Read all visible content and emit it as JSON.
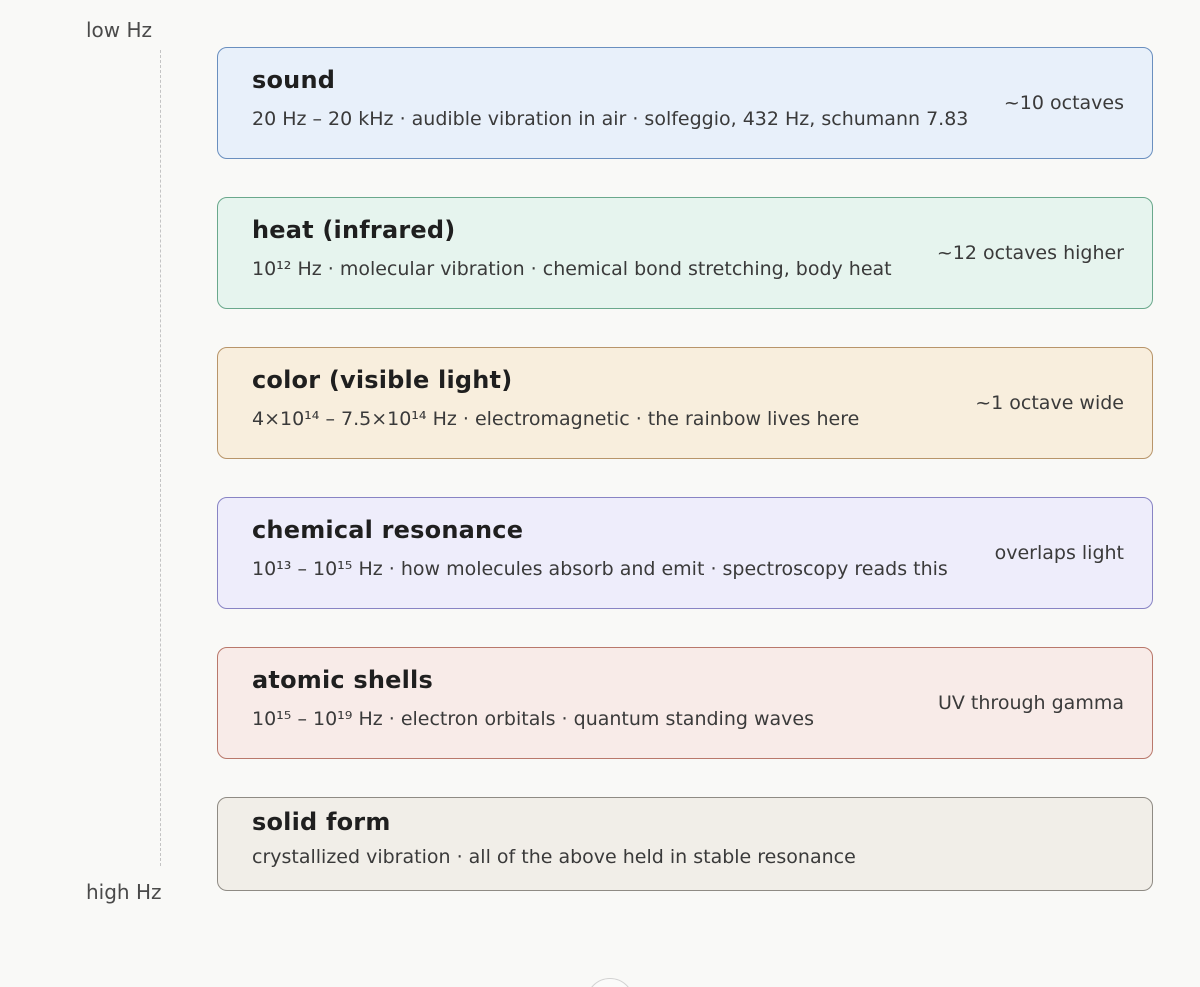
{
  "axis": {
    "low_label": "low Hz",
    "high_label": "high Hz"
  },
  "bands": [
    {
      "title": "sound",
      "description": "20 Hz – 20 kHz · audible vibration in air · solfeggio, 432 Hz, schumann 7.83",
      "note": "~10 octaves",
      "fill": "#e8f0fa",
      "border": "#6a8fbf"
    },
    {
      "title": "heat (infrared)",
      "description": "10¹² Hz · molecular vibration · chemical bond stretching, body heat",
      "note": "~12 octaves higher",
      "fill": "#e6f4ee",
      "border": "#6aa88c"
    },
    {
      "title": "color (visible light)",
      "description": "4×10¹⁴ – 7.5×10¹⁴ Hz · electromagnetic · the rainbow lives here",
      "note": "~1 octave wide",
      "fill": "#f8eedd",
      "border": "#b8956a"
    },
    {
      "title": "chemical resonance",
      "description": "10¹³ – 10¹⁵ Hz · how molecules absorb and emit · spectroscopy reads this",
      "note": "overlaps light",
      "fill": "#eeedfb",
      "border": "#8884c4"
    },
    {
      "title": "atomic shells",
      "description": "10¹⁵ – 10¹⁹ Hz · electron orbitals · quantum standing waves",
      "note": "UV through gamma",
      "fill": "#f8ebe8",
      "border": "#b9786b"
    },
    {
      "title": "solid form",
      "description": "crystallized vibration · all of the above held in stable resonance",
      "note": "",
      "fill": "#f1eee8",
      "border": "#8f8b84"
    }
  ]
}
